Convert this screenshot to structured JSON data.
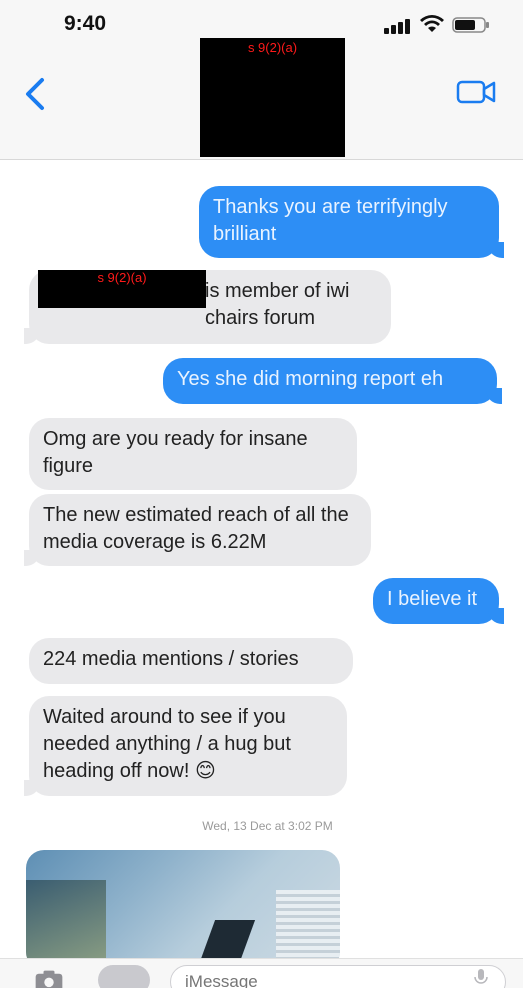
{
  "status_bar": {
    "time": "9:40"
  },
  "header": {
    "redaction_label": "s 9(2)(a)"
  },
  "messages": [
    {
      "side": "out",
      "text": "Thanks you are terrifyingly brilliant"
    },
    {
      "side": "in",
      "redaction_label": "s 9(2)(a)",
      "text": "is member of iwi chairs forum"
    },
    {
      "side": "out",
      "text": "Yes she did morning report eh"
    },
    {
      "side": "in",
      "text": "Omg are you ready for insane figure"
    },
    {
      "side": "in",
      "text": "The new estimated reach of all the media coverage is 6.22M"
    },
    {
      "side": "out",
      "text": "I believe it"
    },
    {
      "side": "in",
      "text": "224 media mentions / stories"
    },
    {
      "side": "in",
      "text": "Waited around to see if you needed anything / a hug but heading off now! 😊"
    }
  ],
  "timestamp": "Wed, 13 Dec at 3:02 PM",
  "composer": {
    "placeholder": "iMessage"
  },
  "colors": {
    "outgoing": "#2d8ef5",
    "incoming": "#e9e9eb",
    "accent": "#1a7cf0",
    "redaction": "#000000",
    "redaction_text": "#ff1a1a"
  },
  "icons": [
    "back-chevron-icon",
    "video-call-icon",
    "camera-icon",
    "app-store-icon",
    "microphone-icon",
    "signal-icon",
    "wifi-icon",
    "battery-icon"
  ]
}
